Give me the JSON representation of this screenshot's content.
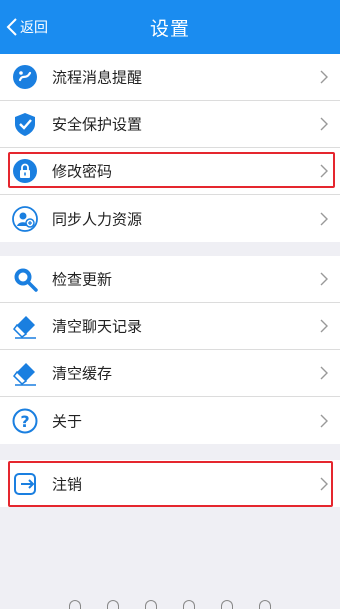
{
  "header": {
    "back_label": "返回",
    "title": "设置",
    "bg_color": "#1a8cf0"
  },
  "groups": [
    {
      "items": [
        {
          "label": "流程消息提醒",
          "icon": "workflow-message-icon"
        },
        {
          "label": "安全保护设置",
          "icon": "shield-check-icon"
        },
        {
          "label": "修改密码",
          "icon": "lock-icon"
        },
        {
          "label": "同步人力资源",
          "icon": "hr-sync-icon"
        }
      ]
    },
    {
      "items": [
        {
          "label": "检查更新",
          "icon": "search-icon"
        },
        {
          "label": "清空聊天记录",
          "icon": "eraser-icon"
        },
        {
          "label": "清空缓存",
          "icon": "eraser-icon"
        },
        {
          "label": "关于",
          "icon": "question-icon"
        }
      ]
    },
    {
      "items": [
        {
          "label": "注销",
          "icon": "logout-icon"
        }
      ]
    }
  ],
  "highlight_color": "#e5262e",
  "icon_color": "#1a7fe0"
}
